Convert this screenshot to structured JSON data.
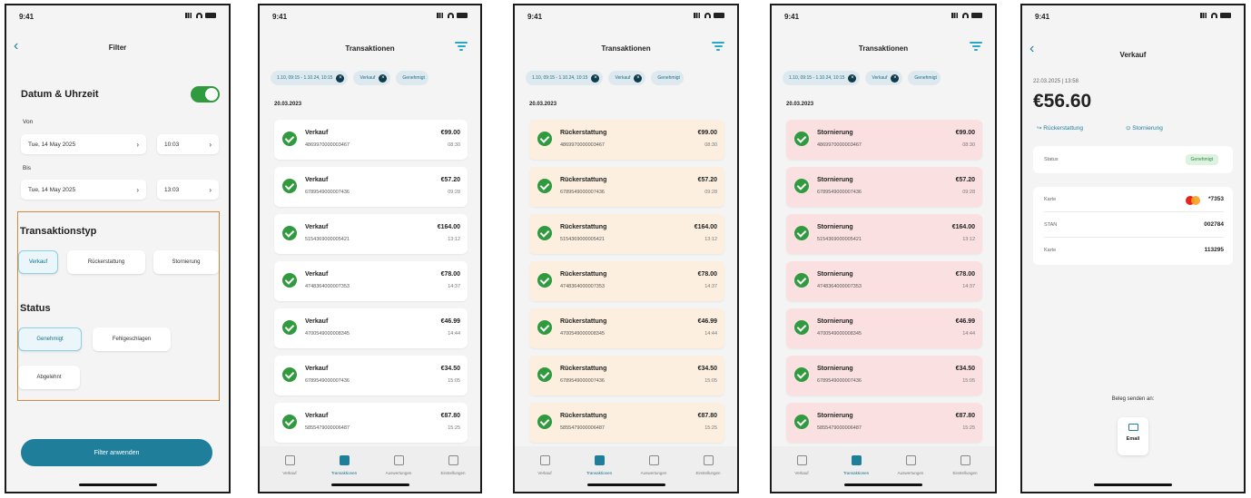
{
  "status_time": "9:41",
  "filter_screen": {
    "title": "Filter",
    "date_section": "Datum & Uhrzeit",
    "from_label": "Von",
    "from_date": "Tue, 14 May 2025",
    "from_time": "10:03",
    "to_label": "Bis",
    "to_date": "Tue, 14 May 2025",
    "to_time": "13:03",
    "type_section": "Transaktionstyp",
    "type_options": [
      "Verkauf",
      "Rückerstattung",
      "Stornierung"
    ],
    "status_section": "Status",
    "status_options": [
      "Genehmigt",
      "Fehlgeschlagen",
      "Abgelehnt"
    ],
    "apply_button": "Filter anwenden"
  },
  "transactions": {
    "title": "Transaktionen",
    "date_header": "20.03.2023",
    "filter_pills": [
      "1.10, 09:15 - 1.10.24, 10:15",
      "Verkauf",
      "Genehmigt"
    ],
    "tabs": [
      "Verkauf",
      "Transaktionen",
      "Auswertungen",
      "Einstellungen"
    ],
    "items": [
      {
        "card": "4869970000003467",
        "amount": "€99.00",
        "time": "08:30"
      },
      {
        "card": "6789549000007436",
        "amount": "€57.20",
        "time": "09:28"
      },
      {
        "card": "5154369000005421",
        "amount": "€164.00",
        "time": "13:12"
      },
      {
        "card": "4748364000007353",
        "amount": "€78.00",
        "time": "14:37"
      },
      {
        "card": "4700549000008345",
        "amount": "€46.99",
        "time": "14:44"
      },
      {
        "card": "6789549000007436",
        "amount": "€34.50",
        "time": "15:05"
      },
      {
        "card": "5855479000006487",
        "amount": "€87.80",
        "time": "15:25"
      }
    ],
    "screen2_label": "Verkauf",
    "screen3_label": "Rückerstattung",
    "screen4_label": "Stornierung"
  },
  "detail": {
    "title": "Verkauf",
    "datetime": "22.03.2025 | 13:58",
    "amount": "€56.60",
    "refund_link": "Rückerstattung",
    "cancel_link": "Stornierung",
    "status_key": "Status",
    "status_value": "Genehmigt",
    "card_key": "Karte",
    "card_value": "*7353",
    "stan_key": "STAN",
    "stan_value": "002784",
    "auth_key": "Karte",
    "auth_value": "113295",
    "receipt_label": "Beleg senden an:",
    "email_label": "Email"
  },
  "colors": {
    "accent": "#1f7f9a",
    "success": "#2f9a3e",
    "refund_bg": "#fcefdf",
    "cancel_bg": "#fbe0e1",
    "highlight": "#d7893b"
  }
}
